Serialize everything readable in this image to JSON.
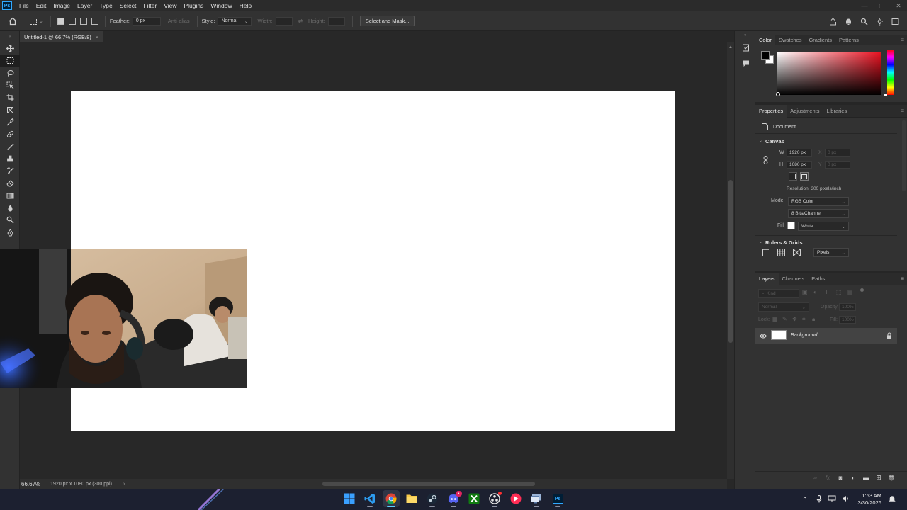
{
  "app": {
    "logo": "Ps"
  },
  "menu": [
    "File",
    "Edit",
    "Image",
    "Layer",
    "Type",
    "Select",
    "Filter",
    "View",
    "Plugins",
    "Window",
    "Help"
  ],
  "window_controls": {
    "minimize": "—",
    "maximize": "▢",
    "close": "✕"
  },
  "options_bar": {
    "feather_label": "Feather:",
    "feather_value": "0 px",
    "antialias_label": "Anti-alias",
    "style_label": "Style:",
    "style_value": "Normal",
    "width_label": "Width:",
    "height_label": "Height:",
    "swap_icon": "⇄",
    "select_mask_label": "Select and Mask..."
  },
  "document": {
    "tab_title": "Untitled-1 @ 66.7% (RGB/8)",
    "tab_close": "×",
    "zoom": "66.67%",
    "doc_info": "1920 px x 1080 px (300 ppi)",
    "status_arrow": "›"
  },
  "color_panel": {
    "tabs": [
      "Color",
      "Swatches",
      "Gradients",
      "Patterns"
    ],
    "active_tab": 0,
    "foreground": "#000000",
    "background": "#ffffff",
    "hue_color": "#e8101f"
  },
  "properties_panel": {
    "tabs": [
      "Properties",
      "Adjustments",
      "Libraries"
    ],
    "active_tab": 0,
    "doc_label": "Document",
    "canvas": {
      "title": "Canvas",
      "w_label": "W",
      "w_value": "1920 px",
      "h_label": "H",
      "h_value": "1080 px",
      "x_label": "X",
      "x_value": "0 px",
      "y_label": "Y",
      "y_value": "0 px",
      "resolution": "Resolution: 300 pixels/inch",
      "mode_label": "Mode",
      "mode_value": "RGB Color",
      "bits_value": "8 Bits/Channel",
      "fill_label": "Fill",
      "fill_value": "White"
    },
    "rulers": {
      "title": "Rulers & Grids",
      "unit_value": "Pixels"
    }
  },
  "layers_panel": {
    "tabs": [
      "Layers",
      "Channels",
      "Paths"
    ],
    "active_tab": 0,
    "kind_placeholder": "Kind",
    "blend_mode": "Normal",
    "opacity_label": "Opacity:",
    "opacity_value": "100%",
    "lock_label": "Lock:",
    "fill_label": "Fill:",
    "fill_value": "100%",
    "layers": [
      {
        "name": "Background",
        "visible": true,
        "locked": true
      }
    ]
  },
  "taskbar": {
    "clock_time": "1:53 AM",
    "clock_date": "3/30/2026"
  }
}
